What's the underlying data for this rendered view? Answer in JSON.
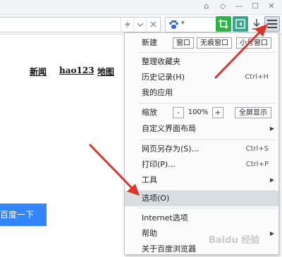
{
  "window": {
    "controls": [
      "⌂",
      "◇",
      "—",
      "☐",
      "✕"
    ]
  },
  "toolbar": {
    "lightning_icon": "lightning-icon",
    "dropdown_icon": "chevron-down-icon",
    "close_icon": "close-icon",
    "search_engine_icon": "paw-icon",
    "search_engine_dropdown": "▾",
    "icons": [
      "crop-icon",
      "collapse-sidebar-icon",
      "download-icon",
      "menu-icon"
    ]
  },
  "page": {
    "links": [
      "新闻",
      "hao123",
      "地图"
    ],
    "search_button": "百度一下"
  },
  "menu": {
    "new_label": "新建",
    "new_buttons": [
      "窗口",
      "无痕窗口",
      "小号窗口"
    ],
    "items_group1": [
      {
        "label": "整理收藏夹",
        "shortcut": ""
      },
      {
        "label": "历史记录(H)",
        "shortcut": "Ctrl+H"
      },
      {
        "label": "我的应用",
        "shortcut": ""
      }
    ],
    "zoom": {
      "label": "缩放",
      "minus": "-",
      "value": "100%",
      "plus": "+",
      "fullscreen": "全屏显示"
    },
    "customize": {
      "label": "自定义界面布局",
      "arrow": "▶"
    },
    "items_group2": [
      {
        "label": "网页另存为(S)...",
        "shortcut": "Ctrl+S"
      },
      {
        "label": "打印(P)...",
        "shortcut": "Ctrl+P"
      },
      {
        "label": "工具",
        "arrow": "▶"
      }
    ],
    "options": {
      "label": "选项(O)"
    },
    "items_group3": [
      {
        "label": "Internet选项"
      },
      {
        "label": "帮助",
        "arrow": "▶"
      },
      {
        "label": "关于百度浏览器"
      }
    ]
  },
  "watermark": "Baidu 经验",
  "colors": {
    "arrow": "#d9362c",
    "search_button": "#3385ff",
    "highlight": "#d8dde2"
  }
}
